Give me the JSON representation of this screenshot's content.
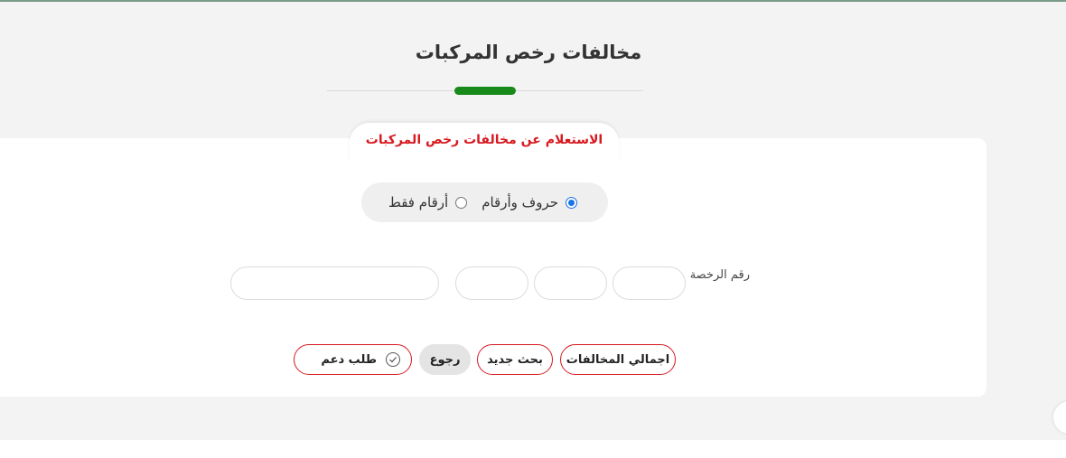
{
  "page": {
    "title": "مخالفات رخص المركبات"
  },
  "form": {
    "card_title": "الاستعلام عن مخالفات رخص المركبات",
    "radio_options": [
      {
        "label": "حروف وأرقام",
        "checked": true
      },
      {
        "label": "أرقام فقط",
        "checked": false
      }
    ],
    "license_label": "رقم الرخصة",
    "inputs": [
      "",
      "",
      "",
      ""
    ]
  },
  "buttons": {
    "total_violations": "اجمالي المخالفات",
    "new_search": "بحث جديد",
    "back": "رجوع",
    "support_request": "طلب دعم"
  },
  "colors": {
    "accent_green": "#178a1a",
    "accent_red": "#d71920",
    "radio_blue": "#1a73e8"
  },
  "icons": {
    "support_icon": "check-circle-icon"
  }
}
